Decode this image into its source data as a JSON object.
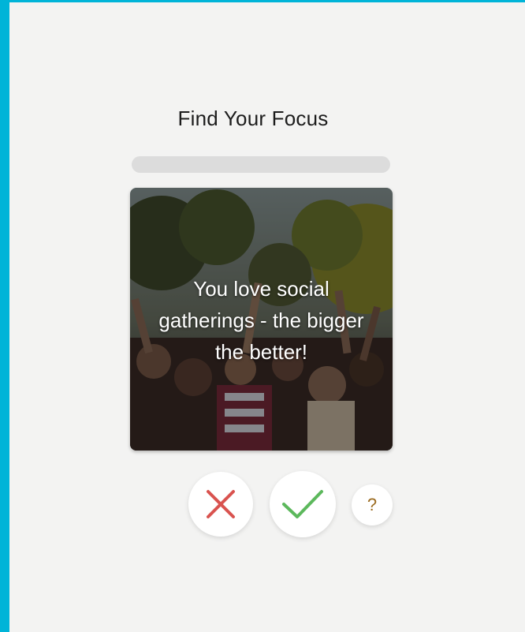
{
  "app": {
    "title": "Find Your Focus"
  },
  "progress": {
    "fraction": 0.0
  },
  "card": {
    "statement": "You love social gatherings - the bigger the better!",
    "image": "crowd-at-festival-photo"
  },
  "actions": {
    "reject_icon": "close-icon",
    "accept_icon": "check-icon",
    "help_label": "?"
  },
  "colors": {
    "accent": "#00b4d8",
    "background": "#f3f3f2",
    "reject": "#d9534f",
    "accept": "#5cb85c",
    "help": "#9a6a1e"
  }
}
